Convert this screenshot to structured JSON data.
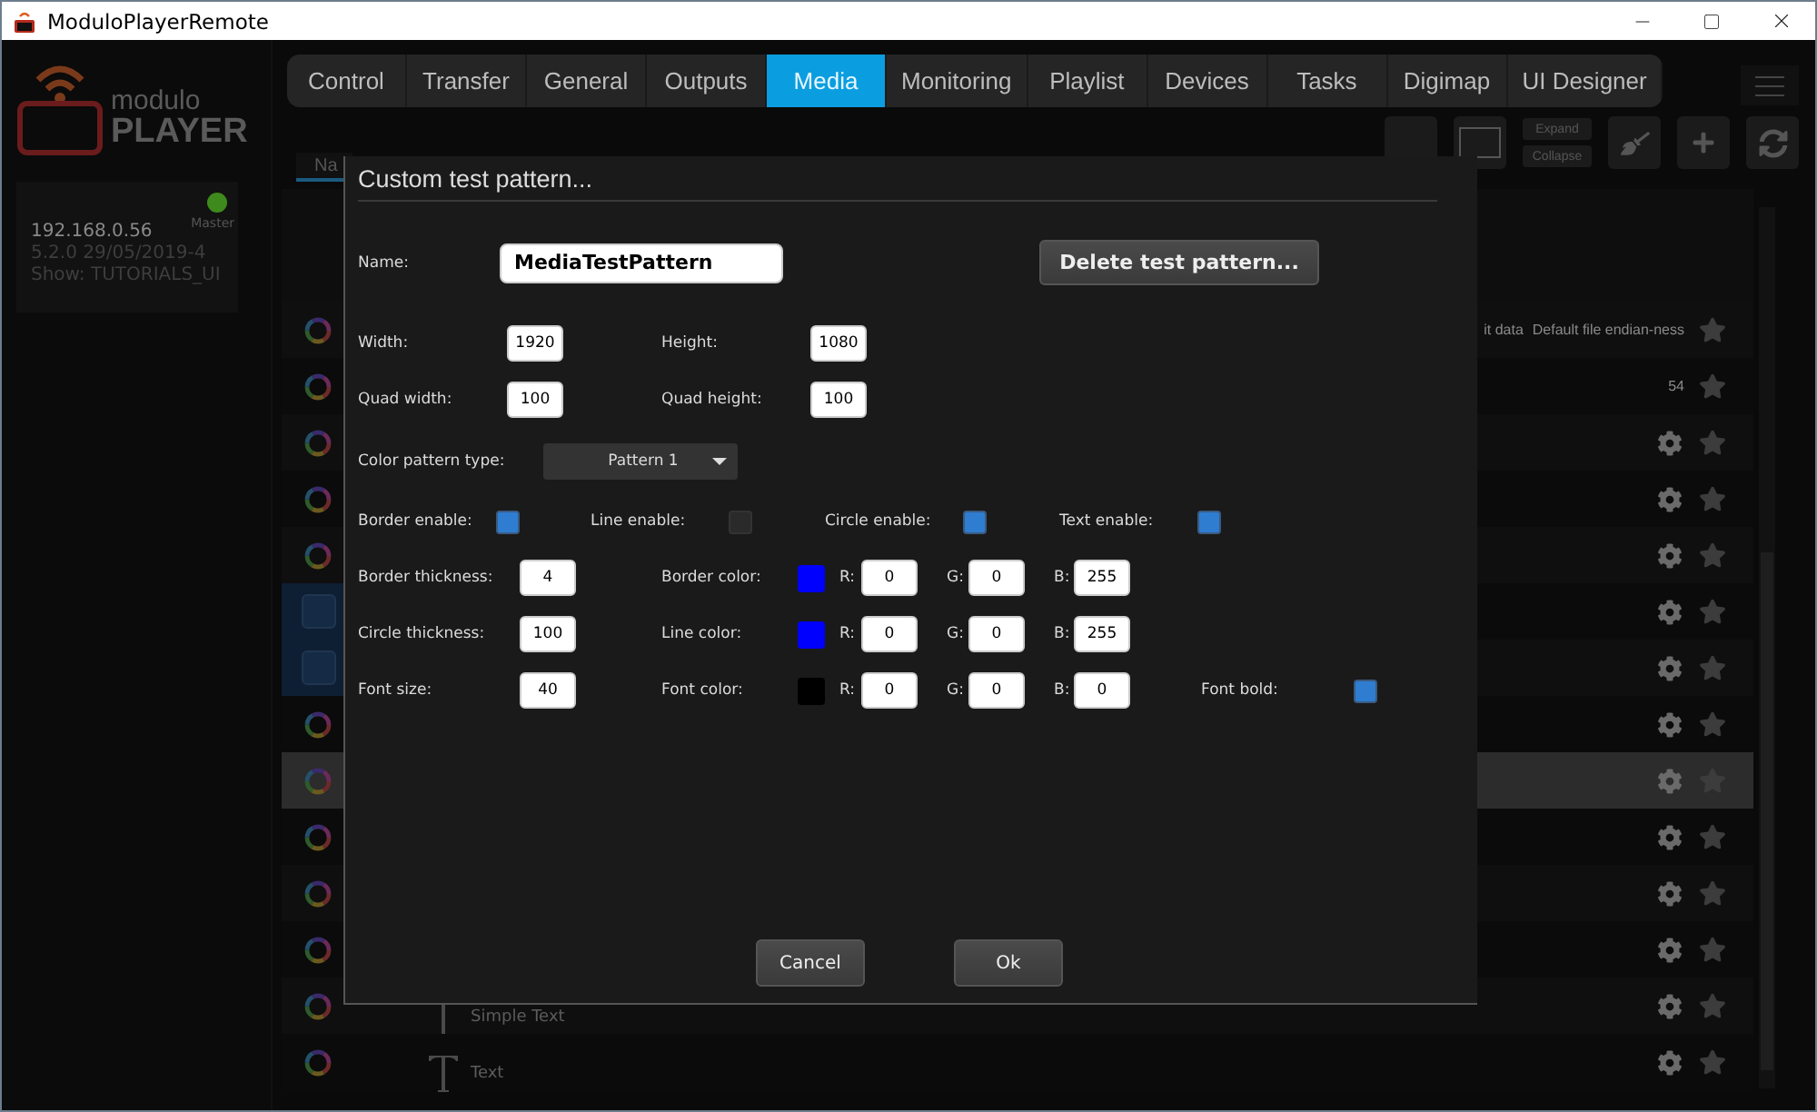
{
  "window": {
    "title": "ModuloPlayerRemote"
  },
  "logo": {
    "line_1": "modulo",
    "line_2": "PLAYER"
  },
  "device": {
    "ip": "192.168.0.56",
    "version": "5.2.0 29/05/2019-4",
    "show": "Show: TUTORIALS_UI",
    "role": "Master",
    "online": true
  },
  "tabs": [
    {
      "label": "Control",
      "selected": false
    },
    {
      "label": "Transfer",
      "selected": false
    },
    {
      "label": "General",
      "selected": false
    },
    {
      "label": "Outputs",
      "selected": false
    },
    {
      "label": "Media",
      "selected": true
    },
    {
      "label": "Monitoring",
      "selected": false
    },
    {
      "label": "Playlist",
      "selected": false
    },
    {
      "label": "Devices",
      "selected": false
    },
    {
      "label": "Tasks",
      "selected": false
    },
    {
      "label": "Digimap",
      "selected": false
    },
    {
      "label": "UI Designer",
      "selected": false
    }
  ],
  "toolbar": {
    "expand": "Expand",
    "collapse": "Collapse"
  },
  "list_tab": {
    "label": "Na"
  },
  "rows": [
    {
      "kind": "wheel",
      "info": [
        "it data",
        "Default file endian-ness"
      ],
      "gear": false,
      "star": true,
      "highlighted": false
    },
    {
      "kind": "wheel",
      "info": [
        "54"
      ],
      "gear": false,
      "star": true,
      "highlighted": false
    },
    {
      "kind": "wheel",
      "gear": true,
      "star": true,
      "highlighted": false
    },
    {
      "kind": "wheel",
      "gear": true,
      "star": true,
      "highlighted": false
    },
    {
      "kind": "wheel",
      "gear": true,
      "star": true,
      "highlighted": false
    },
    {
      "kind": "square",
      "gear": true,
      "star": true,
      "highlighted": false
    },
    {
      "kind": "square",
      "gear": true,
      "star": true,
      "highlighted": false
    },
    {
      "kind": "wheel",
      "gear": true,
      "star": true,
      "highlighted": false
    },
    {
      "kind": "wheel",
      "gear": true,
      "star": true,
      "highlighted": true
    },
    {
      "kind": "wheel",
      "gear": true,
      "star": true,
      "highlighted": false
    },
    {
      "kind": "wheel",
      "gear": true,
      "star": true,
      "highlighted": false
    },
    {
      "kind": "wheel",
      "gear": true,
      "star": true,
      "highlighted": false
    },
    {
      "kind": "wheel",
      "title": "Simple Text",
      "gear": true,
      "star": true,
      "highlighted": false
    },
    {
      "kind": "wheel",
      "title": "Text",
      "gear": true,
      "star": true,
      "highlighted": false
    }
  ],
  "dialog": {
    "title": "Custom test pattern...",
    "name_label": "Name:",
    "name_value": "MediaTestPattern",
    "delete_button": "Delete test pattern...",
    "size_rows": [
      [
        {
          "label": "Width:",
          "value": "1920"
        },
        {
          "label": "Height:",
          "value": "1080"
        }
      ],
      [
        {
          "label": "Quad width:",
          "value": "100"
        },
        {
          "label": "Quad height:",
          "value": "100"
        }
      ]
    ],
    "pattern": {
      "label": "Color pattern type:",
      "value": "Pattern 1"
    },
    "enables": [
      {
        "label": "Border enable:",
        "checked": true
      },
      {
        "label": "Line enable:",
        "checked": false
      },
      {
        "label": "Circle enable:",
        "checked": true
      },
      {
        "label": "Text enable:",
        "checked": true
      }
    ],
    "color_rows": [
      {
        "label": "Border thickness:",
        "value": "4",
        "color_label": "Border color:",
        "color": "#0000ff",
        "channels": [
          {
            "label": "R:",
            "value": "0"
          },
          {
            "label": "G:",
            "value": "0"
          },
          {
            "label": "B:",
            "value": "255"
          }
        ]
      },
      {
        "label": "Circle thickness:",
        "value": "100",
        "color_label": "Line color:",
        "color": "#0000ff",
        "channels": [
          {
            "label": "R:",
            "value": "0"
          },
          {
            "label": "G:",
            "value": "0"
          },
          {
            "label": "B:",
            "value": "255"
          }
        ]
      },
      {
        "label": "Font size:",
        "value": "40",
        "color_label": "Font color:",
        "color": "#000000",
        "channels": [
          {
            "label": "R:",
            "value": "0"
          },
          {
            "label": "G:",
            "value": "0"
          },
          {
            "label": "B:",
            "value": "0"
          }
        ],
        "toggle": {
          "label": "Font bold:",
          "checked": true
        }
      }
    ],
    "buttons": [
      "Cancel",
      "Ok"
    ]
  }
}
